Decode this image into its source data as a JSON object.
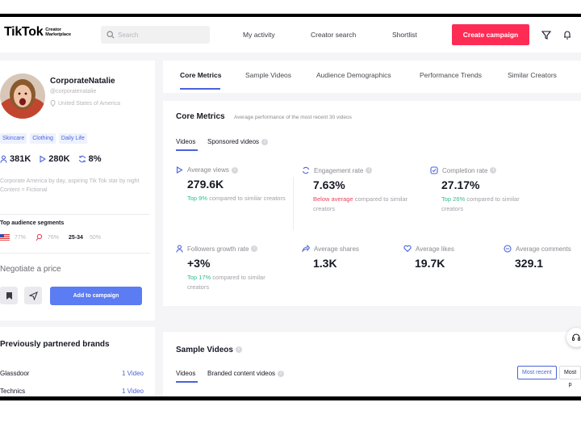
{
  "colors": {
    "brand": "#fe2c55",
    "accent": "#4a63d8",
    "positive": "#2fbf8a",
    "negative": "#f0445a"
  },
  "header": {
    "logo_text": "TikTok",
    "logo_sub": "Creator Marketplace",
    "search_placeholder": "Search",
    "nav": [
      "My activity",
      "Creator search",
      "Shortlist"
    ],
    "create_button": "Create campaign",
    "icons": [
      "filter-icon",
      "bell-icon"
    ]
  },
  "profile": {
    "name": "CorporateNatalie",
    "handle": "@corporatenatalie",
    "location": "United States of America",
    "tags": [
      "Skincare",
      "Clothing",
      "Daily Life"
    ],
    "stats": {
      "followers": "381K",
      "views": "280K",
      "engagement": "8%"
    },
    "bio": "Corporate America by day, aspiring Tik Tok star by night Content = Fictional",
    "segments_title": "Top audience segments",
    "segments": {
      "country_pct": "77%",
      "gender_pct": "76%",
      "age_range": "25-34",
      "age_pct": "50%"
    },
    "negotiate": "Negotiate a price",
    "add_button": "Add to campaign"
  },
  "brands": {
    "title": "Previously partnered brands",
    "rows": [
      {
        "name": "Glassdoor",
        "count": "1 Video"
      },
      {
        "name": "Technics",
        "count": "1 Video"
      }
    ]
  },
  "tabs": [
    "Core Metrics",
    "Sample Videos",
    "Audience Demographics",
    "Performance Trends",
    "Similar Creators"
  ],
  "core_metrics": {
    "title": "Core Metrics",
    "subtitle": "Average performance of the most recent 30 videos",
    "subtabs": [
      "Videos",
      "Sponsored videos"
    ],
    "metrics": [
      {
        "label": "Average views",
        "value": "279.6K",
        "highlight": "Top 9%",
        "rest": " compared to similar creators",
        "tone": "green"
      },
      {
        "label": "Engagement rate",
        "value": "7.63%",
        "highlight": "Below average",
        "rest": " compared to similar creators",
        "tone": "red"
      },
      {
        "label": "Completion rate",
        "value": "27.17%",
        "highlight": "Top 26%",
        "rest": " compared to similar creators",
        "tone": "green"
      },
      {
        "label": "Followers growth rate",
        "value": "+3%",
        "highlight": "Top 17%",
        "rest": " compared to similar creators",
        "tone": "green"
      },
      {
        "label": "Average shares",
        "value": "1.3K"
      },
      {
        "label": "Average likes",
        "value": "19.7K"
      },
      {
        "label": "Average comments",
        "value": "329.1"
      }
    ]
  },
  "sample_videos": {
    "title": "Sample Videos",
    "subtabs": [
      "Videos",
      "Branded content videos"
    ],
    "sort": [
      "Most recent",
      "Most p"
    ]
  }
}
